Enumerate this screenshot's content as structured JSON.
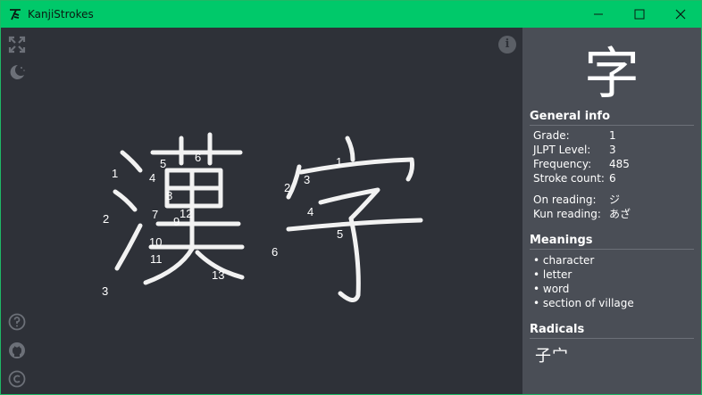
{
  "window": {
    "title": "KanjiStrokes"
  },
  "main": {
    "display_kanji": [
      "漢",
      "字"
    ],
    "kanji1_numbers": [
      "1",
      "2",
      "3",
      "4",
      "5",
      "6",
      "7",
      "8",
      "9",
      "10",
      "11",
      "12",
      "13"
    ],
    "kanji2_numbers": [
      "1",
      "2",
      "3",
      "4",
      "5",
      "6"
    ]
  },
  "tools": {
    "fullscreen": "fullscreen-icon",
    "theme": "moon-icon",
    "help": "help-icon",
    "github": "github-icon",
    "copyright": "copyright-icon",
    "info": "i"
  },
  "sidebar": {
    "kanji": "字",
    "general_title": "General info",
    "grade": {
      "label": "Grade:",
      "value": "1"
    },
    "jlpt": {
      "label": "JLPT Level:",
      "value": "3"
    },
    "frequency": {
      "label": "Frequency:",
      "value": "485"
    },
    "strokes": {
      "label": "Stroke count:",
      "value": "6"
    },
    "on": {
      "label": "On reading:",
      "value": "ジ"
    },
    "kun": {
      "label": "Kun reading:",
      "value": "あざ"
    },
    "meanings_title": "Meanings",
    "meanings": [
      "• character",
      "• letter",
      "• word",
      "• section of village"
    ],
    "radicals_title": "Radicals",
    "radicals": "子宀"
  },
  "colors": {
    "titlebar": "#00c96a",
    "canvas": "#2e3138",
    "sidebar": "#4a4e56"
  }
}
